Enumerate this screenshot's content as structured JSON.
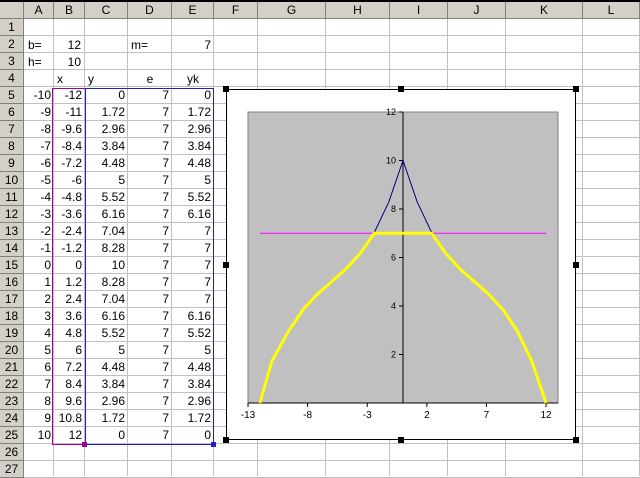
{
  "columns": [
    "A",
    "B",
    "C",
    "D",
    "E",
    "F",
    "G",
    "H",
    "I",
    "J",
    "K",
    "L"
  ],
  "rows": [
    "1",
    "2",
    "3",
    "4",
    "5",
    "6",
    "7",
    "8",
    "9",
    "10",
    "11",
    "12",
    "13",
    "14",
    "15",
    "16",
    "17",
    "18",
    "19",
    "20",
    "21",
    "22",
    "23",
    "24",
    "25",
    "26",
    "27"
  ],
  "params": {
    "b_label": "b=",
    "b_value": "12",
    "h_label": "h=",
    "h_value": "10",
    "m_label": "m=",
    "m_value": "7"
  },
  "headers": {
    "x": "x",
    "y": "y",
    "e": "e",
    "yk": "yk"
  },
  "table": [
    [
      "-10",
      "-12",
      "0",
      "7",
      "0"
    ],
    [
      "-9",
      "-11",
      "1.72",
      "7",
      "1.72"
    ],
    [
      "-8",
      "-9.6",
      "2.96",
      "7",
      "2.96"
    ],
    [
      "-7",
      "-8.4",
      "3.84",
      "7",
      "3.84"
    ],
    [
      "-6",
      "-7.2",
      "4.48",
      "7",
      "4.48"
    ],
    [
      "-5",
      "-6",
      "5",
      "7",
      "5"
    ],
    [
      "-4",
      "-4.8",
      "5.52",
      "7",
      "5.52"
    ],
    [
      "-3",
      "-3.6",
      "6.16",
      "7",
      "6.16"
    ],
    [
      "-2",
      "-2.4",
      "7.04",
      "7",
      "7"
    ],
    [
      "-1",
      "-1.2",
      "8.28",
      "7",
      "7"
    ],
    [
      "0",
      "0",
      "10",
      "7",
      "7"
    ],
    [
      "1",
      "1.2",
      "8.28",
      "7",
      "7"
    ],
    [
      "2",
      "2.4",
      "7.04",
      "7",
      "7"
    ],
    [
      "3",
      "3.6",
      "6.16",
      "7",
      "6.16"
    ],
    [
      "4",
      "4.8",
      "5.52",
      "7",
      "5.52"
    ],
    [
      "5",
      "6",
      "5",
      "7",
      "5"
    ],
    [
      "6",
      "7.2",
      "4.48",
      "7",
      "4.48"
    ],
    [
      "7",
      "8.4",
      "3.84",
      "7",
      "3.84"
    ],
    [
      "8",
      "9.6",
      "2.96",
      "7",
      "2.96"
    ],
    [
      "9",
      "10.8",
      "1.72",
      "7",
      "1.72"
    ],
    [
      "10",
      "12",
      "0",
      "7",
      "0"
    ]
  ],
  "chart_data": {
    "type": "scatter",
    "x": [
      -12,
      -11,
      -9.6,
      -8.4,
      -7.2,
      -6,
      -4.8,
      -3.6,
      -2.4,
      -1.2,
      0,
      1.2,
      2.4,
      3.6,
      4.8,
      6,
      7.2,
      8.4,
      9.6,
      10.8,
      12
    ],
    "series": [
      {
        "values": [
          0,
          1.72,
          2.96,
          3.84,
          4.48,
          5,
          5.52,
          6.16,
          7.04,
          8.28,
          10,
          8.28,
          7.04,
          6.16,
          5.52,
          5,
          4.48,
          3.84,
          2.96,
          1.72,
          0
        ],
        "color": "#000080"
      },
      {
        "values": [
          7,
          7,
          7,
          7,
          7,
          7,
          7,
          7,
          7,
          7,
          7,
          7,
          7,
          7,
          7,
          7,
          7,
          7,
          7,
          7,
          7
        ],
        "color": "#ff00ff"
      },
      {
        "values": [
          0,
          1.72,
          2.96,
          3.84,
          4.48,
          5,
          5.52,
          6.16,
          7,
          7,
          7,
          7,
          7,
          6.16,
          5.52,
          5,
          4.48,
          3.84,
          2.96,
          1.72,
          0
        ],
        "color": "#ffff00"
      }
    ],
    "xticks": [
      "-13",
      "-8",
      "-3",
      "2",
      "7",
      "12"
    ],
    "yticks": [
      "2",
      "4",
      "6",
      "8",
      "10",
      "12"
    ],
    "xlim": [
      -13,
      13
    ],
    "ylim": [
      0,
      12
    ],
    "plot_background": "#c0c0c0",
    "grid": false,
    "legend": "none"
  }
}
